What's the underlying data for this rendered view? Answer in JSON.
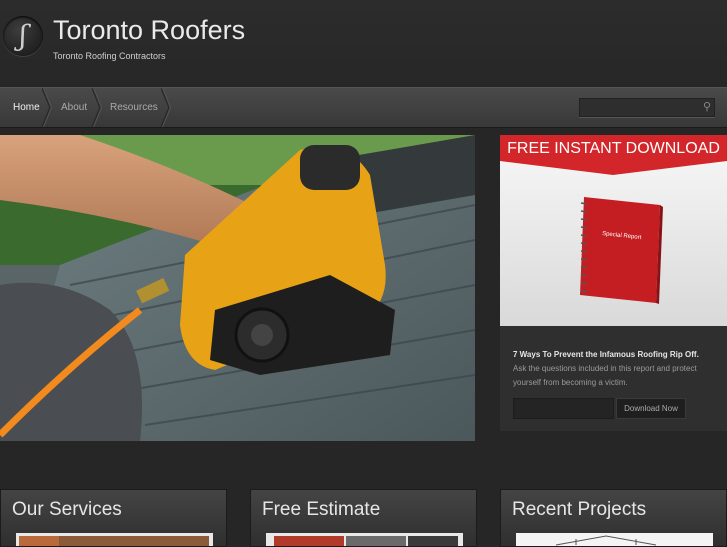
{
  "site": {
    "logo_glyph": "ʃ",
    "title": "Toronto Roofers",
    "tagline": "Toronto Roofing Contractors"
  },
  "nav": {
    "items": [
      {
        "label": "Home",
        "active": true
      },
      {
        "label": "About",
        "active": false
      },
      {
        "label": "Resources",
        "active": false
      }
    ],
    "search_placeholder": ""
  },
  "sidebar": {
    "banner": "FREE INSTANT DOWNLOAD",
    "book_title": "Special Report",
    "report_title": "7 Ways To Prevent the Infamous Roofing Rip Off.",
    "report_desc": "Ask the questions included in this report and protect yourself from becoming a victim.",
    "email_placeholder": "",
    "button_label": "Download Now"
  },
  "panels": [
    {
      "title": "Our Services"
    },
    {
      "title": "Free Estimate"
    },
    {
      "title": "Recent Projects"
    }
  ],
  "colors": {
    "accent_red": "#d2262a",
    "background": "#262626"
  }
}
